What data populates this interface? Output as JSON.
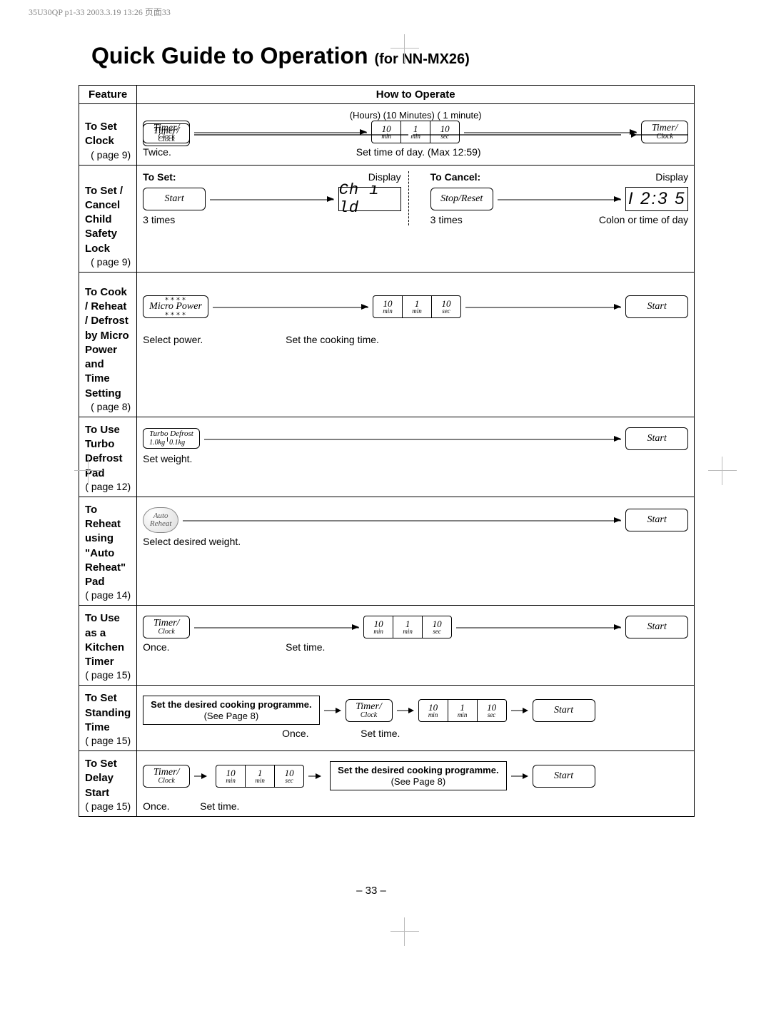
{
  "printmark": "35U30QP p1-33 2003.3.19 13:26 页面33",
  "title_main": "Quick Guide to Operation ",
  "title_sub": "(for NN-MX26)",
  "headers": {
    "feature": "Feature",
    "operate": "How to Operate"
  },
  "pagenum": "– 33 –",
  "buttons": {
    "timer_clock_l1": "Timer/",
    "timer_clock_l2": "Clock",
    "start": "Start",
    "stop_reset": "Stop/Reset",
    "micro_power": "Micro Power"
  },
  "dials": {
    "d10min": {
      "num": "10",
      "unit": "min"
    },
    "d1min": {
      "num": "1",
      "unit": "min"
    },
    "d10sec": {
      "num": "10",
      "unit": "sec"
    }
  },
  "turbo": {
    "title": "Turbo Defrost",
    "w1": "1.0kg",
    "w2": "0.1kg"
  },
  "auto_reheat": {
    "l1": "Auto",
    "l2": "Reheat"
  },
  "displays": {
    "child": "Ch ı ld",
    "time": "I 2:3 5"
  },
  "rows": {
    "clock": {
      "title": "To Set Clock",
      "page": "(    page 9)",
      "top_labels": "(Hours) (10 Minutes) ( 1 minute)",
      "c_twice": "Twice.",
      "c_set": "Set time of day. (Max 12:59)"
    },
    "child": {
      "title": "To Set / Cancel Child Safety Lock",
      "page": "(    page 9)",
      "set": "To Set:",
      "display": "Display",
      "c_3times": "3 times",
      "cancel": "To Cancel:",
      "c_colon": "Colon or time of day"
    },
    "cook": {
      "title": "To Cook / Reheat / Defrost by Micro Power and Time Setting",
      "page": "(    page 8)",
      "c_sel": "Select power.",
      "c_time": "Set the cooking time."
    },
    "turbo": {
      "title": "To Use Turbo Defrost Pad",
      "page": "(    page 12)",
      "c_weight": "Set weight."
    },
    "reheat": {
      "title": "To Reheat using \"Auto Reheat\" Pad",
      "page": "(    page 14)",
      "c_sel": "Select desired weight."
    },
    "ktimer": {
      "title": "To Use as a Kitchen Timer",
      "page": "(    page 15)",
      "c_once": "Once.",
      "c_set": "Set time."
    },
    "standing": {
      "title": "To Set Standing Time",
      "page": "(    page 15)",
      "box1": "Set the desired cooking programme.",
      "box_sub": "(See Page 8)",
      "c_once": "Once.",
      "c_set": "Set time."
    },
    "delay": {
      "title": "To Set Delay Start",
      "page": "(    page 15)",
      "box1": "Set the desired cooking programme.",
      "box_sub": "(See Page 8)",
      "c_once": "Once.",
      "c_set": "Set time."
    }
  }
}
